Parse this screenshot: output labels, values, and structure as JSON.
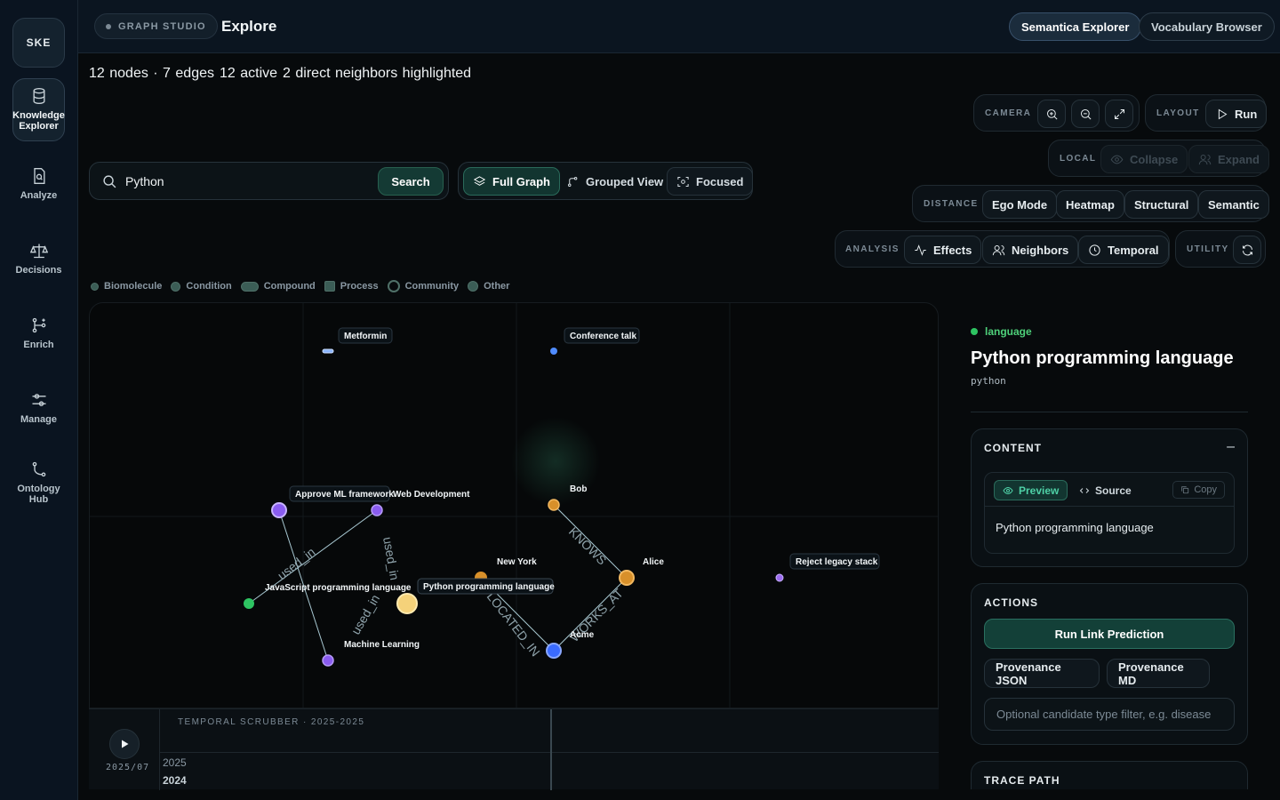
{
  "sidebar": {
    "logo": "SKE",
    "items": [
      {
        "label": "Knowledge Explorer",
        "icon": "database-icon"
      },
      {
        "label": "Analyze",
        "icon": "document-search-icon"
      },
      {
        "label": "Decisions",
        "icon": "scale-icon"
      },
      {
        "label": "Enrich",
        "icon": "git-merge-icon"
      },
      {
        "label": "Manage",
        "icon": "sliders-icon"
      },
      {
        "label": "Ontology Hub",
        "icon": "branch-icon"
      }
    ]
  },
  "header": {
    "studio_label": "GRAPH STUDIO",
    "title": "Explore",
    "buttons": [
      "Semantica Explorer",
      "Vocabulary Browser"
    ]
  },
  "stats": {
    "counts": "12 nodes · 7 edges",
    "active": "12 active",
    "highlighted": "2 direct neighbors highlighted"
  },
  "search": {
    "value": "Python",
    "button": "Search"
  },
  "views": [
    "Full Graph",
    "Grouped View",
    "Focused"
  ],
  "toolbar": {
    "camera": "CAMERA",
    "layout": "LAYOUT",
    "run": "Run",
    "local": "LOCAL",
    "collapse": "Collapse",
    "expand": "Expand",
    "distance": "DISTANCE",
    "distance_modes": [
      "Ego Mode",
      "Heatmap",
      "Structural",
      "Semantic"
    ],
    "analysis": "ANALYSIS",
    "analysis_modes": [
      "Effects",
      "Neighbors",
      "Temporal"
    ],
    "utility": "UTILITY"
  },
  "legend": [
    "Biomolecule",
    "Condition",
    "Compound",
    "Process",
    "Community",
    "Other"
  ],
  "graph": {
    "nodes": [
      {
        "label": "Metformin",
        "color": "#8ab4ff"
      },
      {
        "label": "Conference talk",
        "color": "#4f8cff"
      },
      {
        "label": "Approve ML framework",
        "color": "#8a5cf0"
      },
      {
        "label": "Web Development",
        "color": "#8a5cf0"
      },
      {
        "label": "Bob",
        "color": "#d8902a"
      },
      {
        "label": "Alice",
        "color": "#d8902a"
      },
      {
        "label": "New York",
        "color": "#d8902a"
      },
      {
        "label": "Python programming language",
        "color": "#f5d27a"
      },
      {
        "label": "JavaScript programming language",
        "color": "#2ec462"
      },
      {
        "label": "Machine Learning",
        "color": "#8a5cf0"
      },
      {
        "label": "Acme",
        "color": "#3a6bff"
      },
      {
        "label": "Reject legacy stack",
        "color": "#9c6cf0"
      }
    ],
    "edge_labels": [
      "used_in",
      "used_in",
      "used_in",
      "KNOWS",
      "LOCATED_IN",
      "WORKS_AT"
    ]
  },
  "scrubber": {
    "title": "TEMPORAL SCRUBBER · 2025-2025",
    "date": "2025/07",
    "year_a": "2025",
    "year_b": "2024"
  },
  "detail": {
    "type": "language",
    "title": "Python programming language",
    "id": "python",
    "content_title": "CONTENT",
    "collapse_symbol": "–",
    "tab_preview": "Preview",
    "tab_source": "Source",
    "copy": "Copy",
    "preview_text": "Python programming language",
    "actions_title": "ACTIONS",
    "run_link": "Run Link Prediction",
    "prov_json": "Provenance JSON",
    "prov_md": "Provenance MD",
    "filter_placeholder": "Optional candidate type filter, e.g. disease",
    "trace_title": "TRACE PATH"
  }
}
